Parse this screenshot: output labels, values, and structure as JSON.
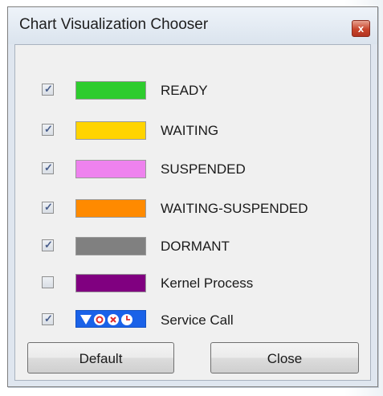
{
  "window": {
    "title": "Chart Visualization Chooser",
    "close_symbol": "x"
  },
  "items": [
    {
      "label": "READY",
      "checked": true,
      "color": "#2ecc2e"
    },
    {
      "label": "WAITING",
      "checked": true,
      "color": "#ffd400"
    },
    {
      "label": "SUSPENDED",
      "checked": true,
      "color": "#ee82ee"
    },
    {
      "label": "WAITING-SUSPENDED",
      "checked": true,
      "color": "#ff8a00"
    },
    {
      "label": "DORMANT",
      "checked": true,
      "color": "#808080"
    },
    {
      "label": "Kernel Process",
      "checked": false,
      "color": "#800080"
    },
    {
      "label": "Service Call",
      "checked": true,
      "color": "#1a62e8",
      "icon": "service-call-glyphs"
    }
  ],
  "buttons": {
    "default_label": "Default",
    "close_label": "Close"
  },
  "check_mark": "✓"
}
